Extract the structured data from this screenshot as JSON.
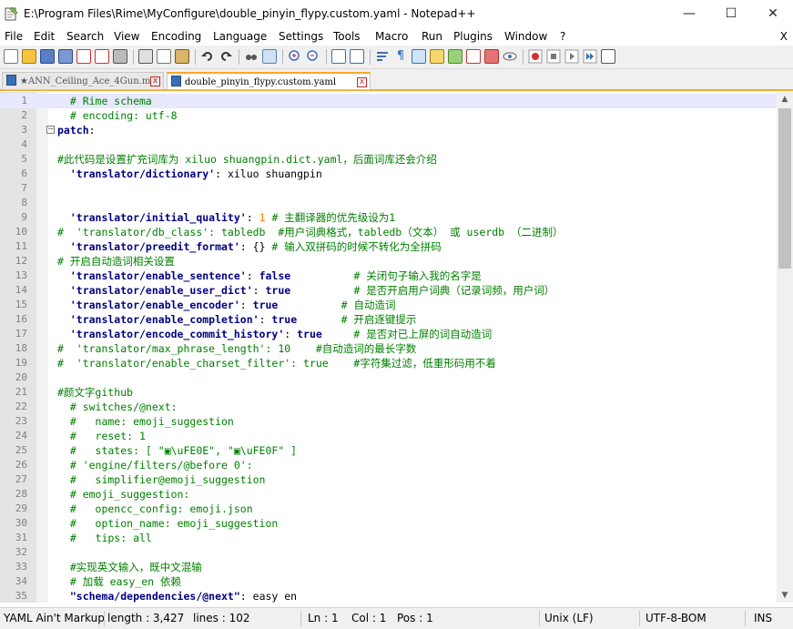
{
  "window": {
    "title": "E:\\Program Files\\Rime\\MyConfigure\\double_pinyin_flypy.custom.yaml - Notepad++",
    "minimize": "—",
    "maximize": "☐",
    "close": "✕"
  },
  "menu": [
    "File",
    "Edit",
    "Search",
    "View",
    "Encoding",
    "Language",
    "Settings",
    "Tools",
    "Macro",
    "Run",
    "Plugins",
    "Window",
    "?"
  ],
  "menu_close": "X",
  "tabs": [
    {
      "label": "★ANN_Ceiling_Ace_4Gun.m",
      "close": "x"
    },
    {
      "label": "double_pinyin_flypy.custom.yaml",
      "close": "x"
    }
  ],
  "editor": {
    "lines": [
      {
        "n": "1",
        "segs": [
          [
            "c",
            "  # Rime schema"
          ]
        ]
      },
      {
        "n": "2",
        "segs": [
          [
            "c",
            "  # encoding: utf-8"
          ]
        ]
      },
      {
        "n": "3",
        "fold": "−",
        "segs": [
          [
            "k",
            "patch"
          ],
          [
            "p",
            ":"
          ]
        ]
      },
      {
        "n": "4",
        "segs": []
      },
      {
        "n": "5",
        "segs": [
          [
            "c",
            "#此代码是设置扩充词库为 xiluo shuangpin.dict.yaml，后面词库还会介绍"
          ]
        ]
      },
      {
        "n": "6",
        "segs": [
          [
            "v",
            "  'translator/dictionary'"
          ],
          [
            "p",
            ": xiluo shuangpin"
          ]
        ]
      },
      {
        "n": "7",
        "segs": []
      },
      {
        "n": "8",
        "segs": []
      },
      {
        "n": "9",
        "segs": [
          [
            "v",
            "  'translator/initial_quality'"
          ],
          [
            "p",
            ": "
          ],
          [
            "n",
            "1"
          ],
          [
            "c",
            " # 主翻译器的优先级设为1"
          ]
        ]
      },
      {
        "n": "10",
        "segs": [
          [
            "c",
            "#  'translator/db_class': tabledb  #用户词典格式，tabledb（文本） 或 userdb （二进制）"
          ]
        ]
      },
      {
        "n": "11",
        "segs": [
          [
            "v",
            "  'translator/preedit_format'"
          ],
          [
            "p",
            ": {} "
          ],
          [
            "c",
            "# 输入双拼码的时候不转化为全拼码"
          ]
        ]
      },
      {
        "n": "12",
        "segs": [
          [
            "c",
            "# 开启自动造词相关设置"
          ]
        ]
      },
      {
        "n": "13",
        "segs": [
          [
            "v",
            "  'translator/enable_sentence'"
          ],
          [
            "p",
            ": "
          ],
          [
            "v",
            "false"
          ],
          [
            "c",
            "          # 关闭句子输入我的名字是"
          ]
        ]
      },
      {
        "n": "14",
        "segs": [
          [
            "v",
            "  'translator/enable_user_dict'"
          ],
          [
            "p",
            ": "
          ],
          [
            "v",
            "true"
          ],
          [
            "c",
            "          # 是否开启用户词典（记录词频，用户词）"
          ]
        ]
      },
      {
        "n": "15",
        "segs": [
          [
            "v",
            "  'translator/enable_encoder'"
          ],
          [
            "p",
            ": "
          ],
          [
            "v",
            "true"
          ],
          [
            "c",
            "          # 自动造词"
          ]
        ]
      },
      {
        "n": "16",
        "segs": [
          [
            "v",
            "  'translator/enable_completion'"
          ],
          [
            "p",
            ": "
          ],
          [
            "v",
            "true"
          ],
          [
            "c",
            "       # 开启逐键提示"
          ]
        ]
      },
      {
        "n": "17",
        "segs": [
          [
            "v",
            "  'translator/encode_commit_history'"
          ],
          [
            "p",
            ": "
          ],
          [
            "v",
            "true"
          ],
          [
            "c",
            "     # 是否对已上屏的词自动造词"
          ]
        ]
      },
      {
        "n": "18",
        "segs": [
          [
            "c",
            "#  'translator/max_phrase_length': 10    #自动造词的最长字数"
          ]
        ]
      },
      {
        "n": "19",
        "segs": [
          [
            "c",
            "#  'translator/enable_charset_filter': true    #字符集过滤，低重形码用不着"
          ]
        ]
      },
      {
        "n": "20",
        "segs": []
      },
      {
        "n": "21",
        "segs": [
          [
            "c",
            "#颜文字github"
          ]
        ]
      },
      {
        "n": "22",
        "segs": [
          [
            "c",
            "  # switches/@next:"
          ]
        ]
      },
      {
        "n": "23",
        "segs": [
          [
            "c",
            "  #   name: emoji_suggestion"
          ]
        ]
      },
      {
        "n": "24",
        "segs": [
          [
            "c",
            "  #   reset: 1"
          ]
        ]
      },
      {
        "n": "25",
        "segs": [
          [
            "c",
            "  #   states: [ \"▣\\uFE0E\", \"▣\\uFE0F\" ]"
          ]
        ]
      },
      {
        "n": "26",
        "segs": [
          [
            "c",
            "  # 'engine/filters/@before 0':"
          ]
        ]
      },
      {
        "n": "27",
        "segs": [
          [
            "c",
            "  #   simplifier@emoji_suggestion"
          ]
        ]
      },
      {
        "n": "28",
        "segs": [
          [
            "c",
            "  # emoji_suggestion:"
          ]
        ]
      },
      {
        "n": "29",
        "segs": [
          [
            "c",
            "  #   opencc_config: emoji.json"
          ]
        ]
      },
      {
        "n": "30",
        "segs": [
          [
            "c",
            "  #   option_name: emoji_suggestion"
          ]
        ]
      },
      {
        "n": "31",
        "segs": [
          [
            "c",
            "  #   tips: all"
          ]
        ]
      },
      {
        "n": "32",
        "segs": []
      },
      {
        "n": "33",
        "segs": [
          [
            "c",
            "  #实现英文输入，既中文混输"
          ]
        ]
      },
      {
        "n": "34",
        "segs": [
          [
            "c",
            "  # 加载 easy_en 依赖"
          ]
        ]
      },
      {
        "n": "35",
        "segs": [
          [
            "v",
            "  \"schema/dependencies/@next\""
          ],
          [
            "p",
            ": easy en"
          ]
        ]
      }
    ]
  },
  "status": {
    "language": "YAML Ain't Markup",
    "length": "length : 3,427",
    "lines": "lines : 102",
    "ln": "Ln : 1",
    "col": "Col : 1",
    "pos": "Pos : 1",
    "eol": "Unix (LF)",
    "encoding": "UTF-8-BOM",
    "mode": "INS"
  },
  "colors": {
    "comment": "#008000",
    "key": "#000080",
    "number": "#ff8000",
    "tab_accent": "#f9a825"
  }
}
